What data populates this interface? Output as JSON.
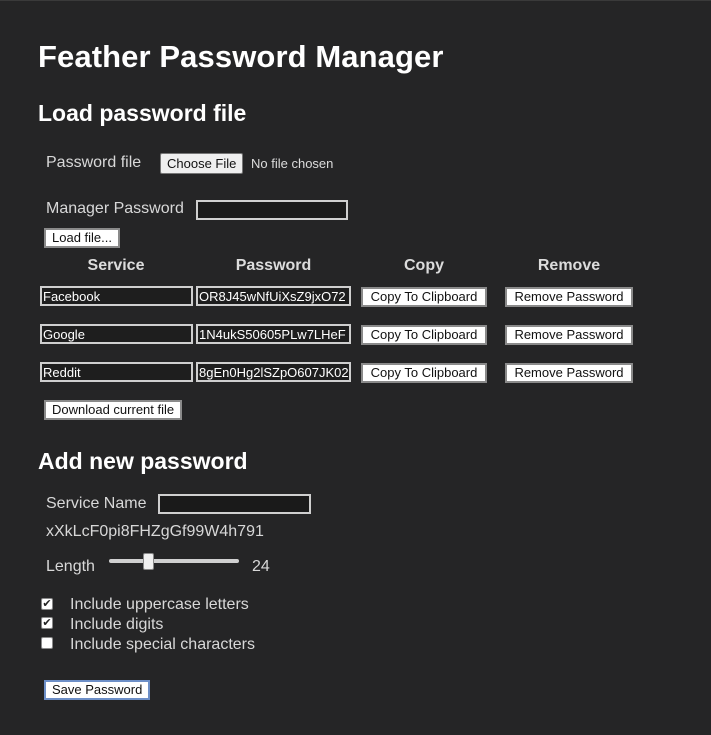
{
  "app": {
    "title": "Feather Password Manager"
  },
  "load_section": {
    "heading": "Load password file",
    "password_file_label": "Password file",
    "choose_file_label": "Choose File",
    "no_file_text": "No file chosen",
    "manager_password_label": "Manager Password",
    "manager_password_value": "",
    "load_button": "Load file..."
  },
  "table": {
    "headers": {
      "service": "Service",
      "password": "Password",
      "copy": "Copy",
      "remove": "Remove"
    },
    "rows": [
      {
        "service": "Facebook",
        "password": "OR8J45wNfUiXsZ9jxO72",
        "copy_label": "Copy To Clipboard",
        "remove_label": "Remove Password"
      },
      {
        "service": "Google",
        "password": "1N4ukS50605PLw7LHeF",
        "copy_label": "Copy To Clipboard",
        "remove_label": "Remove Password"
      },
      {
        "service": "Reddit",
        "password": "8gEn0Hg2lSZpO607JK02",
        "copy_label": "Copy To Clipboard",
        "remove_label": "Remove Password"
      }
    ],
    "download_button": "Download current file"
  },
  "add_section": {
    "heading": "Add new password",
    "service_name_label": "Service Name",
    "service_name_value": "",
    "generated_password": "xXkLcF0pi8FHZgGf99W4h791",
    "length_label": "Length",
    "length_value": "24",
    "length_slider": {
      "min": 8,
      "max": 64,
      "value": 24
    },
    "options": [
      {
        "label": "Include uppercase letters",
        "checked": true
      },
      {
        "label": "Include digits",
        "checked": true
      },
      {
        "label": "Include special characters",
        "checked": false
      }
    ],
    "save_button": "Save Password"
  }
}
